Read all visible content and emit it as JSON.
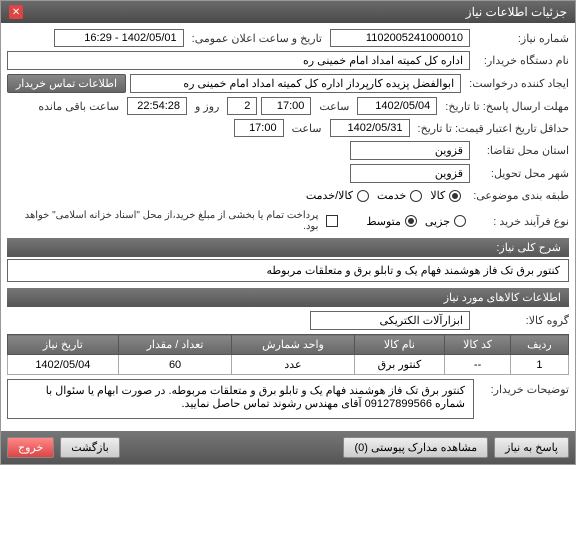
{
  "window": {
    "title": "جزئیات اطلاعات نیاز"
  },
  "fields": {
    "need_no_lbl": "شماره نیاز:",
    "need_no": "1102005241000010",
    "announce_lbl": "تاریخ و ساعت اعلان عمومی:",
    "announce_val": "1402/05/01 - 16:29",
    "org_lbl": "نام دستگاه خریدار:",
    "org_val": "اداره کل کمیته امداد امام خمینی ره",
    "creator_lbl": "ایجاد کننده درخواست:",
    "creator_val": "ابوالفضل پزیده کارپرداز اداره کل کمیته امداد امام خمینی ره",
    "contact_btn": "اطلاعات تماس خریدار",
    "deadline_lbl": "مهلت ارسال پاسخ: تا تاریخ:",
    "deadline_date": "1402/05/04",
    "time_lbl": "ساعت",
    "deadline_time": "17:00",
    "days": "2",
    "days_lbl": "روز و",
    "remaining": "22:54:28",
    "remaining_lbl": "ساعت باقی مانده",
    "validity_lbl": "حداقل تاریخ اعتبار قیمت: تا تاریخ:",
    "validity_date": "1402/05/31",
    "validity_time": "17:00",
    "loc_req_lbl": "استان محل تقاضا:",
    "loc_req_val": "قزوین",
    "loc_del_lbl": "شهر محل تحویل:",
    "loc_del_val": "قزوین",
    "category_lbl": "طبقه بندی موضوعی:",
    "cat_goods": "کالا",
    "cat_service": "خدمت",
    "cat_both": "کالا/خدمت",
    "purchase_lbl": "نوع فرآیند خرید :",
    "p_small": "جزیی",
    "p_medium": "متوسط",
    "payment_note": "پرداخت تمام یا بخشی از مبلغ خرید،از محل \"اسناد خزانه اسلامی\" خواهد بود.",
    "desc_lbl": "شرح کلی نیاز:",
    "desc_val": "کنتور برق تک فاز هوشمند فهام یک و تابلو برق و متعلقات مربوطه",
    "info_hdr": "اطلاعات کالاهای مورد نیاز",
    "group_lbl": "گروه کالا:",
    "group_val": "ابزارآلات الکتریکی",
    "buyer_note_lbl": "توضیحات خریدار:",
    "buyer_note_val": "کنتور برق تک فاز هوشمند فهام یک و تابلو برق و متعلقات مربوطه. در صورت ابهام یا سئوال با شماره 09127899566 آقای مهندس رشوند تماس حاصل نمایید."
  },
  "table": {
    "headers": [
      "ردیف",
      "کد کالا",
      "نام کالا",
      "واحد شمارش",
      "تعداد / مقدار",
      "تاریخ نیاز"
    ],
    "row": {
      "idx": "1",
      "code": "--",
      "name": "کنتور برق",
      "unit": "عدد",
      "qty": "60",
      "date": "1402/05/04"
    }
  },
  "footer": {
    "respond": "پاسخ به نیاز",
    "attach": "مشاهده مدارک پیوستی (0)",
    "back": "بازگشت",
    "exit": "خروج"
  }
}
